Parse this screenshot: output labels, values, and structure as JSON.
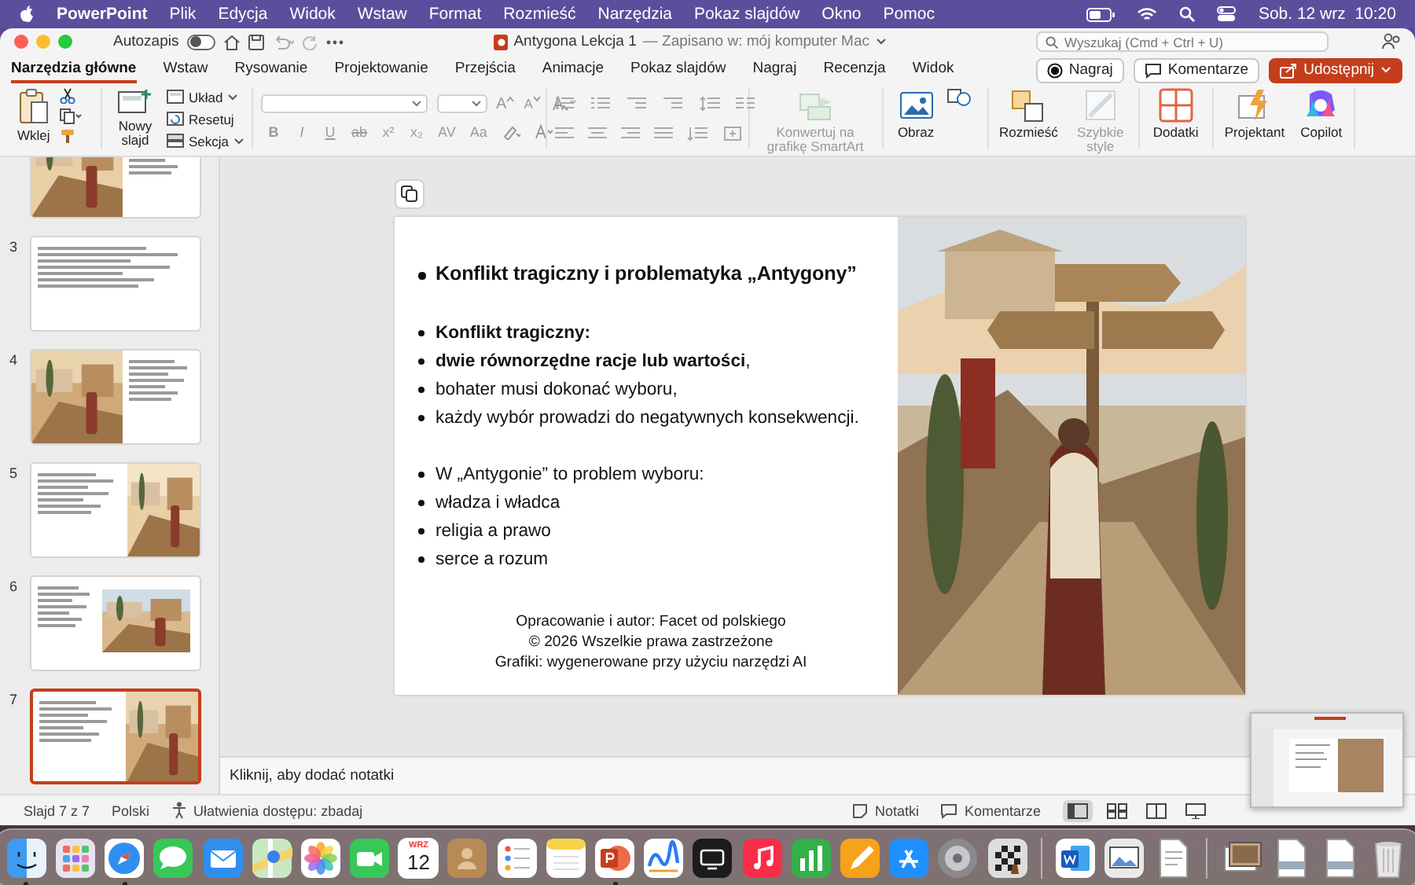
{
  "menu_bar": {
    "app_name": "PowerPoint",
    "items": [
      "Plik",
      "Edycja",
      "Widok",
      "Wstaw",
      "Format",
      "Rozmieść",
      "Narzędzia",
      "Pokaz slajdów",
      "Okno",
      "Pomoc"
    ],
    "clock": "Sob. 12 wrz  10:20"
  },
  "title_bar": {
    "autosave_label": "Autozapis",
    "autosave_on": false,
    "document_title": "Antygona Lekcja 1",
    "save_status": "— Zapisano w: mój komputer Mac",
    "search_placeholder": "Wyszukaj (Cmd + Ctrl + U)"
  },
  "tabs": [
    {
      "label": "Narzędzia główne",
      "selected": true
    },
    {
      "label": "Wstaw",
      "selected": false
    },
    {
      "label": "Rysowanie",
      "selected": false
    },
    {
      "label": "Projektowanie",
      "selected": false
    },
    {
      "label": "Przejścia",
      "selected": false
    },
    {
      "label": "Animacje",
      "selected": false
    },
    {
      "label": "Pokaz slajdów",
      "selected": false
    },
    {
      "label": "Nagraj",
      "selected": false
    },
    {
      "label": "Recenzja",
      "selected": false
    },
    {
      "label": "Widok",
      "selected": false
    }
  ],
  "tab_actions": [
    {
      "kind": "record",
      "label": "Nagraj"
    },
    {
      "kind": "comments",
      "label": "Komentarze"
    },
    {
      "kind": "share",
      "label": "Udostępnij"
    }
  ],
  "ribbon": {
    "paste_label": "Wklej",
    "new_slide_label": "Nowy slajd",
    "slide_commands": [
      "Układ",
      "Resetuj",
      "Sekcja"
    ],
    "grow_shrink": [
      "A",
      "A"
    ],
    "font_buttons": [
      "B",
      "I",
      "U",
      "ab",
      "x²",
      "x₂",
      "AV",
      "Aa"
    ],
    "tools": [
      {
        "label": "Konwertuj na grafikę SmartArt",
        "disabled": true
      },
      {
        "label": "Obraz",
        "disabled": false
      },
      {
        "label": "Rozmieść",
        "disabled": false
      },
      {
        "label": "Szybkie style",
        "disabled": true
      },
      {
        "label": "Dodatki",
        "disabled": false
      },
      {
        "label": "Projektant",
        "disabled": false
      },
      {
        "label": "Copilot",
        "disabled": false
      }
    ]
  },
  "slides": [
    {
      "selected": false
    },
    {
      "number": "3",
      "selected": false
    },
    {
      "number": "4",
      "selected": false
    },
    {
      "number": "5",
      "selected": false
    },
    {
      "number": "6",
      "selected": false
    },
    {
      "number": "7",
      "selected": true
    }
  ],
  "slide": {
    "title": "Konflikt tragiczny i problematyka „Antygony”",
    "bullet_groups": [
      [
        {
          "text": "Konflikt tragiczny:",
          "bold": true
        },
        {
          "text": "**dwie równorzędne racje lub wartości**,",
          "bold": false
        },
        {
          "text": "bohater musi dokonać wyboru,",
          "bold": false
        },
        {
          "text": "każdy wybór prowadzi do negatywnych konsekwencji.",
          "bold": false
        }
      ],
      [
        {
          "text": "W „Antygonie” to problem wyboru:",
          "bold": false
        },
        {
          "text": "władza i władca",
          "bold": false
        },
        {
          "text": "religia a prawo",
          "bold": false
        },
        {
          "text": "serce a rozum",
          "bold": false
        }
      ]
    ],
    "footer": [
      "Opracowanie i autor: Facet od polskiego",
      "© 2026 Wszelkie prawa zastrzeżone",
      "Grafiki: wygenerowane przy użyciu narzędzi AI"
    ]
  },
  "notes_placeholder": "Kliknij, aby dodać notatki",
  "status_bar": {
    "slide_position": "Slajd 7 z 7",
    "language": "Polski",
    "accessibility": "Ułatwienia dostępu: zbadaj",
    "notes_label": "Notatki",
    "comments_label": "Komentarze",
    "views": [
      {
        "selected": true
      },
      {
        "selected": false
      },
      {
        "selected": false
      },
      {
        "selected": false
      }
    ]
  },
  "dock_sections": [
    [
      {
        "running": true
      },
      {
        "running": false
      },
      {
        "running": true
      },
      {
        "running": false
      },
      {
        "running": false
      },
      {
        "running": false
      },
      {
        "running": false
      },
      {
        "running": false
      },
      {
        "running": false,
        "month": "WRZ",
        "day": "12"
      },
      {
        "running": false
      },
      {
        "running": false
      },
      {
        "running": false
      },
      {
        "running": true
      },
      {
        "running": false
      },
      {
        "running": false
      },
      {
        "running": false
      },
      {
        "running": false
      },
      {
        "running": false
      },
      {
        "running": false
      },
      {
        "running": false
      },
      {
        "running": false
      }
    ],
    [
      {
        "running": false
      },
      {
        "running": false
      },
      {
        "running": false
      }
    ],
    [
      {
        "running": false
      },
      {
        "running": false
      },
      {
        "running": false
      },
      {
        "running": false
      }
    ]
  ]
}
